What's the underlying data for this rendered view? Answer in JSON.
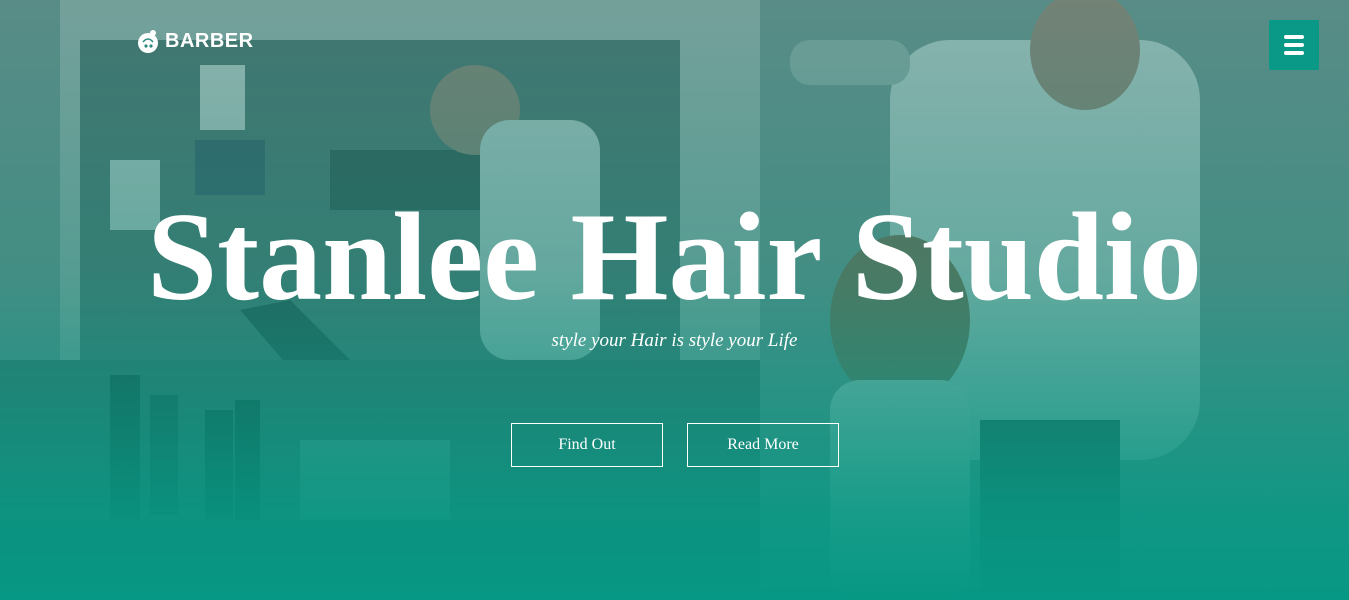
{
  "brand": {
    "name": "BARBER",
    "icon": "barber-logo-icon"
  },
  "menu": {
    "icon": "hamburger-menu-icon",
    "color": "#0a9987"
  },
  "hero": {
    "title": "Stanlee Hair Studio",
    "subtitle": "style your Hair is style your Life",
    "buttons": {
      "find_out": "Find Out",
      "read_more": "Read More"
    },
    "overlay_color": "#069884"
  }
}
